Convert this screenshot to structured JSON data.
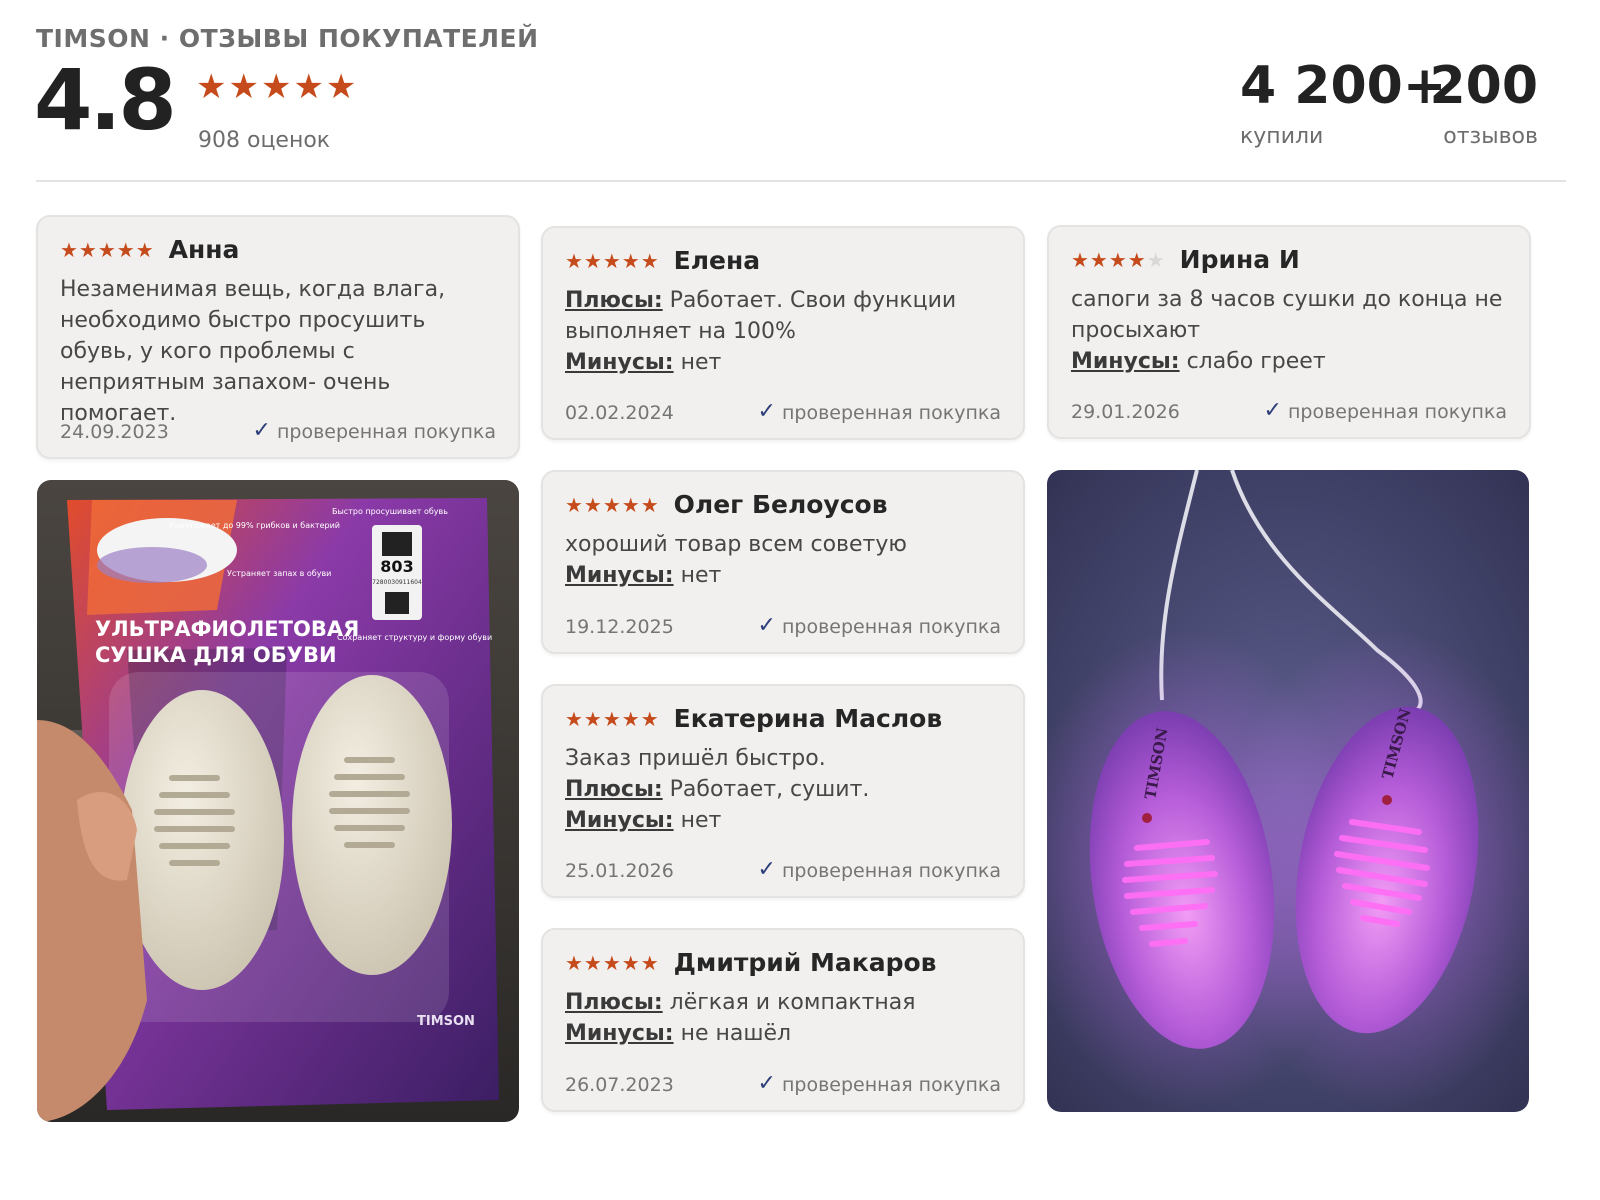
{
  "header": {
    "brand_title": "TIMSON · ОТЗЫВЫ ПОКУПАТЕЛЕЙ",
    "rating": "4.8",
    "rating_stars": "★★★★★",
    "ratings_count": "908 оценок",
    "bought_value": "4 200+",
    "bought_label": "купили",
    "reviews_value": "200",
    "reviews_label": "отзывов"
  },
  "colors": {
    "star": "#c64b1c",
    "star_empty": "#d9d8d6",
    "check": "#2d3f7a",
    "card_bg": "#f1f0ee"
  },
  "reviews": [
    {
      "author": "Анна",
      "stars_on": "★★★★★",
      "stars_off": "",
      "rating": 5,
      "text": "Незаменимая вещь, когда влага, необходимо быстро просушить обувь, у кого проблемы с неприятным запахом- очень помогает.",
      "date": "24.09.2023",
      "verified": "проверенная покупка"
    },
    {
      "author": "Елена",
      "stars_on": "★★★★★",
      "stars_off": "",
      "rating": 5,
      "plus_label": "Плюсы:",
      "plus": " Работает. Свои функции выполняет на 100%",
      "minus_label": "Минусы:",
      "minus": " нет",
      "date": "02.02.2024",
      "verified": "проверенная покупка"
    },
    {
      "author": "Ирина И",
      "stars_on": "★★★★",
      "stars_off": "★",
      "rating": 4,
      "text": "сапоги за 8 часов сушки до конца не просыхают",
      "minus_label": "Минусы:",
      "minus": " слабо греет",
      "date": "29.01.2026",
      "verified": "проверенная покупка"
    },
    {
      "author": "Олег Белоусов",
      "stars_on": "★★★★★",
      "stars_off": "",
      "rating": 5,
      "text": "хороший товар всем советую",
      "minus_label": "Минусы:",
      "minus": " нет",
      "date": "19.12.2025",
      "verified": "проверенная покупка"
    },
    {
      "author": "Екатерина Маслов",
      "stars_on": "★★★★★",
      "stars_off": "",
      "rating": 5,
      "text": "Заказ пришёл быстро.",
      "plus_label": "Плюсы:",
      "plus": " Работает, сушит.",
      "minus_label": "Минусы:",
      "minus": " нет",
      "date": "25.01.2026",
      "verified": "проверенная покупка"
    },
    {
      "author": "Дмитрий Макаров",
      "stars_on": "★★★★★",
      "stars_off": "",
      "rating": 5,
      "plus_label": "Плюсы:",
      "plus": " лёгкая и компактная",
      "minus_label": "Минусы:",
      "minus": " не нашёл",
      "date": "26.07.2023",
      "verified": "проверенная покупка"
    }
  ],
  "photos": {
    "package": {
      "headline_1": "УЛЬТРАФИОЛЕТОВАЯ",
      "headline_2": "СУШКА ДЛЯ ОБУВИ",
      "sticker_number": "803",
      "sticker_code": "7280030911604",
      "note_1": "Уничтожает до 99% грибков и бактерий",
      "note_2": "Устраняет запах в обуви",
      "note_3": "Быстро просушивает обувь",
      "note_4": "Сохраняет структуру и форму обуви",
      "logo": "TIMSON"
    },
    "uv_dryers": {
      "logo_left": "TIMSON",
      "logo_right": "TIMSON"
    }
  }
}
